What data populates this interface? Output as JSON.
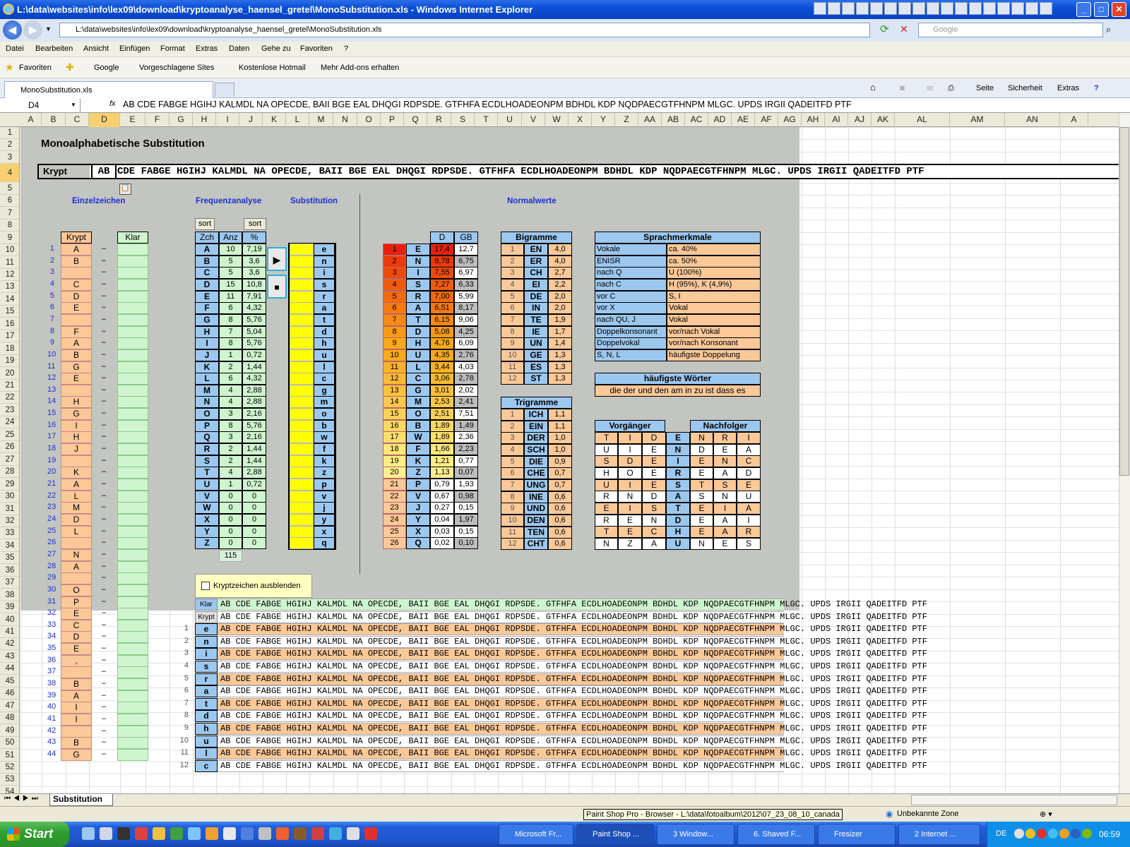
{
  "window": {
    "title": "L:\\data\\websites\\info\\lex09\\download\\kryptoanalyse_haensel_gretel\\MonoSubstitution.xls - Windows Internet Explorer",
    "address": "L:\\data\\websites\\info\\lex09\\download\\kryptoanalyse_haensel_gretel\\MonoSubstitution.xls",
    "search_placeholder": "Google",
    "tab_title": "MonoSubstitution.xls"
  },
  "menu": [
    "Datei",
    "Bearbeiten",
    "Ansicht",
    "Einfügen",
    "Format",
    "Extras",
    "Daten",
    "Gehe zu",
    "Favoriten",
    "?"
  ],
  "favorites": {
    "favorites_label": "Favoriten",
    "links": [
      "Google",
      "Vorgeschlagene Sites",
      "Kostenlose Hotmail",
      "Mehr Add-ons erhalten"
    ]
  },
  "commandbar": {
    "seite": "Seite",
    "sicherheit": "Sicherheit",
    "extras": "Extras"
  },
  "formula_bar": {
    "name_box": "D4",
    "fx": "fx",
    "formula": "AB CDE FABGE HGIHJ KALMDL NA OPECDE, BAII BGE EAL DHQGI RDPSDE. GTFHFA ECDLHOADEONPM BDHDL KDP NQDPAECGTFHNPM MLGC. UPDS IRGII QADEITFD PTF"
  },
  "columns": [
    "A",
    "B",
    "C",
    "D",
    "E",
    "F",
    "G",
    "H",
    "I",
    "J",
    "K",
    "L",
    "M",
    "N",
    "O",
    "P",
    "Q",
    "R",
    "S",
    "T",
    "U",
    "V",
    "W",
    "X",
    "Y",
    "Z",
    "AA",
    "AB",
    "AC",
    "AD",
    "AE",
    "AF",
    "AG",
    "AH",
    "AI",
    "AJ",
    "AK",
    "AL",
    "AM",
    "AN",
    "A"
  ],
  "sheet": {
    "title": "Monoalphabetische Substitution",
    "krypt_label": "Krypt",
    "active_cell_text": "AB",
    "cipher_line": "CDE FABGE HGIHJ KALMDL NA OPECDE, BAII BGE EAL DHQGI RDPSDE. GTFHFA ECDLHOADEONPM BDHDL KDP NQDPAECGTFHNPM MLGC. UPDS IRGII QADEITFD PTF",
    "headers": {
      "einzelzeichen": "Einzelzeichen",
      "frequenzanalyse": "Frequenzanalyse",
      "substitution": "Substitution",
      "normalwerte": "Normalwerte"
    },
    "einzel": {
      "col_krypt": "Krypt",
      "col_klar": "Klar",
      "dash": "–",
      "rows": [
        {
          "n": "1",
          "c": "A"
        },
        {
          "n": "2",
          "c": "B"
        },
        {
          "n": "3",
          "c": ""
        },
        {
          "n": "4",
          "c": "C"
        },
        {
          "n": "5",
          "c": "D"
        },
        {
          "n": "6",
          "c": "E"
        },
        {
          "n": "7",
          "c": ""
        },
        {
          "n": "8",
          "c": "F"
        },
        {
          "n": "9",
          "c": "A"
        },
        {
          "n": "10",
          "c": "B"
        },
        {
          "n": "11",
          "c": "G"
        },
        {
          "n": "12",
          "c": "E"
        },
        {
          "n": "13",
          "c": ""
        },
        {
          "n": "14",
          "c": "H"
        },
        {
          "n": "15",
          "c": "G"
        },
        {
          "n": "16",
          "c": "I"
        },
        {
          "n": "17",
          "c": "H"
        },
        {
          "n": "18",
          "c": "J"
        },
        {
          "n": "19",
          "c": ""
        },
        {
          "n": "20",
          "c": "K"
        },
        {
          "n": "21",
          "c": "A"
        },
        {
          "n": "22",
          "c": "L"
        },
        {
          "n": "23",
          "c": "M"
        },
        {
          "n": "24",
          "c": "D"
        },
        {
          "n": "25",
          "c": "L"
        },
        {
          "n": "26",
          "c": ""
        },
        {
          "n": "27",
          "c": "N"
        },
        {
          "n": "28",
          "c": "A"
        },
        {
          "n": "29",
          "c": ""
        },
        {
          "n": "30",
          "c": "O"
        },
        {
          "n": "31",
          "c": "P"
        },
        {
          "n": "32",
          "c": "E"
        },
        {
          "n": "33",
          "c": "C"
        },
        {
          "n": "34",
          "c": "D"
        },
        {
          "n": "35",
          "c": "E"
        },
        {
          "n": "36",
          "c": ","
        },
        {
          "n": "37",
          "c": ""
        },
        {
          "n": "38",
          "c": "B"
        },
        {
          "n": "39",
          "c": "A"
        },
        {
          "n": "40",
          "c": "I"
        },
        {
          "n": "41",
          "c": "I"
        },
        {
          "n": "42",
          "c": ""
        },
        {
          "n": "43",
          "c": "B"
        },
        {
          "n": "44",
          "c": "G"
        }
      ]
    },
    "freq": {
      "sort_label": "sort",
      "col_zch": "Zch",
      "col_anz": "Anz",
      "col_pct": "%",
      "total": "115",
      "rows": [
        {
          "z": "A",
          "a": "10",
          "p": "7,19",
          "s": "e"
        },
        {
          "z": "B",
          "a": "5",
          "p": "3,6",
          "s": "n"
        },
        {
          "z": "C",
          "a": "5",
          "p": "3,6",
          "s": "i"
        },
        {
          "z": "D",
          "a": "15",
          "p": "10,8",
          "s": "s"
        },
        {
          "z": "E",
          "a": "11",
          "p": "7,91",
          "s": "r"
        },
        {
          "z": "F",
          "a": "6",
          "p": "4,32",
          "s": "a"
        },
        {
          "z": "G",
          "a": "8",
          "p": "5,76",
          "s": "t"
        },
        {
          "z": "H",
          "a": "7",
          "p": "5,04",
          "s": "d"
        },
        {
          "z": "I",
          "a": "8",
          "p": "5,76",
          "s": "h"
        },
        {
          "z": "J",
          "a": "1",
          "p": "0,72",
          "s": "u"
        },
        {
          "z": "K",
          "a": "2",
          "p": "1,44",
          "s": "l"
        },
        {
          "z": "L",
          "a": "6",
          "p": "4,32",
          "s": "c"
        },
        {
          "z": "M",
          "a": "4",
          "p": "2,88",
          "s": "g"
        },
        {
          "z": "N",
          "a": "4",
          "p": "2,88",
          "s": "m"
        },
        {
          "z": "O",
          "a": "3",
          "p": "2,16",
          "s": "o"
        },
        {
          "z": "P",
          "a": "8",
          "p": "5,76",
          "s": "b"
        },
        {
          "z": "Q",
          "a": "3",
          "p": "2,16",
          "s": "w"
        },
        {
          "z": "R",
          "a": "2",
          "p": "1,44",
          "s": "f"
        },
        {
          "z": "S",
          "a": "2",
          "p": "1,44",
          "s": "k"
        },
        {
          "z": "T",
          "a": "4",
          "p": "2,88",
          "s": "z"
        },
        {
          "z": "U",
          "a": "1",
          "p": "0,72",
          "s": "p"
        },
        {
          "z": "V",
          "a": "0",
          "p": "0",
          "s": "v"
        },
        {
          "z": "W",
          "a": "0",
          "p": "0",
          "s": "j"
        },
        {
          "z": "X",
          "a": "0",
          "p": "0",
          "s": "y"
        },
        {
          "z": "Y",
          "a": "0",
          "p": "0",
          "s": "x"
        },
        {
          "z": "Z",
          "a": "0",
          "p": "0",
          "s": "q"
        }
      ]
    },
    "play_buttons": {
      "play": "▶",
      "stop": "■"
    },
    "normal": {
      "col_d": "D",
      "col_gb": "GB",
      "rows": [
        {
          "r": "1",
          "l": "E",
          "d": "17,4",
          "gb": "12,7",
          "col": "#e8200a"
        },
        {
          "r": "2",
          "l": "N",
          "d": "9,78",
          "gb": "6,75",
          "col": "#ec3a0a"
        },
        {
          "r": "3",
          "l": "I",
          "d": "7,55",
          "gb": "6,97",
          "col": "#ee4a0c"
        },
        {
          "r": "4",
          "l": "S",
          "d": "7,27",
          "gb": "6,33",
          "col": "#f05a0e"
        },
        {
          "r": "5",
          "l": "R",
          "d": "7,00",
          "gb": "5,99",
          "col": "#f26a10"
        },
        {
          "r": "6",
          "l": "A",
          "d": "6,51",
          "gb": "8,17",
          "col": "#f47a12"
        },
        {
          "r": "7",
          "l": "T",
          "d": "6,15",
          "gb": "9,06",
          "col": "#f68a14"
        },
        {
          "r": "8",
          "l": "D",
          "d": "5,08",
          "gb": "4,25",
          "col": "#f89a16"
        },
        {
          "r": "9",
          "l": "H",
          "d": "4,76",
          "gb": "6,09",
          "col": "#f8a818"
        },
        {
          "r": "10",
          "l": "U",
          "d": "4,35",
          "gb": "2,76",
          "col": "#faa81e"
        },
        {
          "r": "11",
          "l": "L",
          "d": "3,44",
          "gb": "4,03",
          "col": "#fab22a"
        },
        {
          "r": "12",
          "l": "C",
          "d": "3,06",
          "gb": "2,78",
          "col": "#fbba36"
        },
        {
          "r": "13",
          "l": "G",
          "d": "3,01",
          "gb": "2,02",
          "col": "#fbc040"
        },
        {
          "r": "14",
          "l": "M",
          "d": "2,53",
          "gb": "2,41",
          "col": "#fcc84c"
        },
        {
          "r": "15",
          "l": "O",
          "d": "2,51",
          "gb": "7,51",
          "col": "#fcd058"
        },
        {
          "r": "16",
          "l": "B",
          "d": "1,89",
          "gb": "1,49",
          "col": "#fcd862"
        },
        {
          "r": "17",
          "l": "W",
          "d": "1,89",
          "gb": "2,36",
          "col": "#fde06c"
        },
        {
          "r": "18",
          "l": "F",
          "d": "1,66",
          "gb": "2,23",
          "col": "#fde878"
        },
        {
          "r": "19",
          "l": "K",
          "d": "1,21",
          "gb": "0,77",
          "col": "#fdee84"
        },
        {
          "r": "20",
          "l": "Z",
          "d": "1,13",
          "gb": "0,07",
          "col": "#fef090"
        },
        {
          "r": "21",
          "l": "P",
          "d": "0,79",
          "gb": "1,93",
          "col": "#fbc898"
        },
        {
          "r": "22",
          "l": "V",
          "d": "0,67",
          "gb": "0,98",
          "col": "#fbc898"
        },
        {
          "r": "23",
          "l": "J",
          "d": "0,27",
          "gb": "0,15",
          "col": "#fbc898"
        },
        {
          "r": "24",
          "l": "Y",
          "d": "0,04",
          "gb": "1,97",
          "col": "#fbc898"
        },
        {
          "r": "25",
          "l": "X",
          "d": "0,03",
          "gb": "0,15",
          "col": "#fbc898"
        },
        {
          "r": "26",
          "l": "Q",
          "d": "0,02",
          "gb": "0,10",
          "col": "#fbc898"
        }
      ]
    },
    "bigramme": {
      "title": "Bigramme",
      "rows": [
        {
          "r": "1",
          "b": "EN",
          "v": "4,0"
        },
        {
          "r": "2",
          "b": "ER",
          "v": "4,0"
        },
        {
          "r": "3",
          "b": "CH",
          "v": "2,7"
        },
        {
          "r": "4",
          "b": "EI",
          "v": "2,2"
        },
        {
          "r": "5",
          "b": "DE",
          "v": "2,0"
        },
        {
          "r": "6",
          "b": "IN",
          "v": "2,0"
        },
        {
          "r": "7",
          "b": "TE",
          "v": "1,9"
        },
        {
          "r": "8",
          "b": "IE",
          "v": "1,7"
        },
        {
          "r": "9",
          "b": "UN",
          "v": "1,4"
        },
        {
          "r": "10",
          "b": "GE",
          "v": "1,3"
        },
        {
          "r": "11",
          "b": "ES",
          "v": "1,3"
        },
        {
          "r": "12",
          "b": "ST",
          "v": "1,3"
        }
      ]
    },
    "trigramme": {
      "title": "Trigramme",
      "rows": [
        {
          "r": "1",
          "t": "ICH",
          "v": "1,1"
        },
        {
          "r": "2",
          "t": "EIN",
          "v": "1,1"
        },
        {
          "r": "3",
          "t": "DER",
          "v": "1,0"
        },
        {
          "r": "4",
          "t": "SCH",
          "v": "1,0"
        },
        {
          "r": "5",
          "t": "DIE",
          "v": "0,9"
        },
        {
          "r": "6",
          "t": "CHE",
          "v": "0,7"
        },
        {
          "r": "7",
          "t": "UNG",
          "v": "0,7"
        },
        {
          "r": "8",
          "t": "INE",
          "v": "0,6"
        },
        {
          "r": "9",
          "t": "UND",
          "v": "0,6"
        },
        {
          "r": "10",
          "t": "DEN",
          "v": "0,6"
        },
        {
          "r": "11",
          "t": "TEN",
          "v": "0,6"
        },
        {
          "r": "12",
          "t": "CHT",
          "v": "0,6"
        }
      ]
    },
    "sprach": {
      "title": "Sprachmerkmale",
      "rows": [
        {
          "k": "Vokale",
          "v": "ca. 40%"
        },
        {
          "k": "ENISR",
          "v": "ca. 50%"
        },
        {
          "k": "nach Q",
          "v": "U (100%)"
        },
        {
          "k": "nach C",
          "v": "H (95%), K (4,9%)"
        },
        {
          "k": "vor C",
          "v": "S, I"
        },
        {
          "k": "vor X",
          "v": "Vokal"
        },
        {
          "k": "nach QU, J",
          "v": "Vokal"
        },
        {
          "k": "Doppelkonsonant",
          "v": "vor/nach Vokal"
        },
        {
          "k": "Doppelvokal",
          "v": "vor/nach Konsonant"
        },
        {
          "k": "S, N, L",
          "v": "häufigste Doppelung"
        }
      ]
    },
    "woerter": {
      "title": "häufigste Wörter",
      "text": "die der und den am in zu ist dass es"
    },
    "vn": {
      "vorg_title": "Vorgänger",
      "nachf_title": "Nachfolger",
      "rows": [
        [
          "T",
          "I",
          "D",
          "E",
          "N",
          "R",
          "I"
        ],
        [
          "U",
          "I",
          "E",
          "N",
          "D",
          "E",
          "A"
        ],
        [
          "S",
          "D",
          "E",
          "I",
          "E",
          "N",
          "C"
        ],
        [
          "H",
          "O",
          "E",
          "R",
          "E",
          "A",
          "D"
        ],
        [
          "U",
          "I",
          "E",
          "S",
          "T",
          "S",
          "E"
        ],
        [
          "R",
          "N",
          "D",
          "A",
          "S",
          "N",
          "U"
        ],
        [
          "E",
          "I",
          "S",
          "T",
          "E",
          "I",
          "A"
        ],
        [
          "R",
          "E",
          "N",
          "D",
          "E",
          "A",
          "I"
        ],
        [
          "T",
          "E",
          "C",
          "H",
          "E",
          "A",
          "R"
        ],
        [
          "N",
          "Z",
          "A",
          "U",
          "N",
          "E",
          "S"
        ]
      ]
    },
    "checkbox_label": "Kryptzeichen ausblenden",
    "bottom": {
      "klar_label": "Klar",
      "krypt_label": "Krypt",
      "line": "AB CDE FABGE HGIHJ KALMDL NA OPECDE, BAII BGE EAL DHQGI RDPSDE. GTFHFA ECDLHOADEONPM BDHDL KDP NQDPAECGTFHNPM MLGC. UPDS IRGII QADEITFD PTF",
      "rows": [
        {
          "n": "1",
          "s": "e"
        },
        {
          "n": "2",
          "s": "n"
        },
        {
          "n": "3",
          "s": "i"
        },
        {
          "n": "4",
          "s": "s"
        },
        {
          "n": "5",
          "s": "r"
        },
        {
          "n": "6",
          "s": "a"
        },
        {
          "n": "7",
          "s": "t"
        },
        {
          "n": "8",
          "s": "d"
        },
        {
          "n": "9",
          "s": "h"
        },
        {
          "n": "10",
          "s": "u"
        },
        {
          "n": "11",
          "s": "l"
        },
        {
          "n": "12",
          "s": "c"
        }
      ]
    }
  },
  "sheet_tab": "Substitution",
  "status": {
    "tooltip": "Paint Shop Pro - Browser - L:\\data\\fotoalbum\\2012\\07_23_08_10_canada",
    "zone": "Unbekannte Zone"
  },
  "taskbar": {
    "start": "Start",
    "tasks": [
      "Microsoft Fr...",
      "Paint Shop ...",
      "3 Window...",
      "6. Shaved F...",
      "Fresizer",
      "2 Internet ..."
    ],
    "lang": "DE",
    "clock": "06:59"
  }
}
